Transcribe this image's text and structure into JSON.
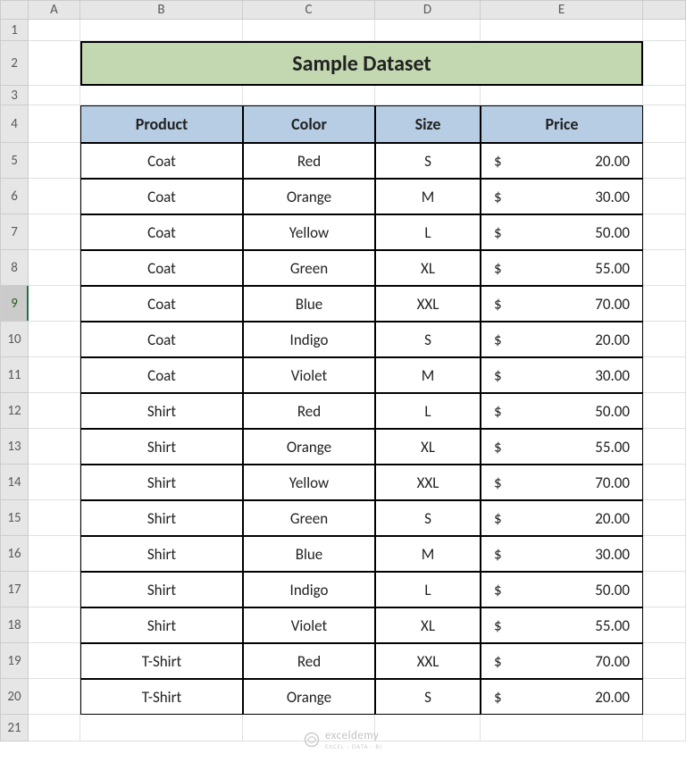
{
  "columns": [
    "A",
    "B",
    "C",
    "D",
    "E"
  ],
  "rows": [
    "1",
    "2",
    "3",
    "4",
    "5",
    "6",
    "7",
    "8",
    "9",
    "10",
    "11",
    "12",
    "13",
    "14",
    "15",
    "16",
    "17",
    "18",
    "19",
    "20",
    "21"
  ],
  "selected_row": "9",
  "title": "Sample Dataset",
  "headers": {
    "product": "Product",
    "color": "Color",
    "size": "Size",
    "price": "Price"
  },
  "currency_symbol": "$",
  "data_rows": [
    {
      "product": "Coat",
      "color": "Red",
      "size": "S",
      "price": "20.00"
    },
    {
      "product": "Coat",
      "color": "Orange",
      "size": "M",
      "price": "30.00"
    },
    {
      "product": "Coat",
      "color": "Yellow",
      "size": "L",
      "price": "50.00"
    },
    {
      "product": "Coat",
      "color": "Green",
      "size": "XL",
      "price": "55.00"
    },
    {
      "product": "Coat",
      "color": "Blue",
      "size": "XXL",
      "price": "70.00"
    },
    {
      "product": "Coat",
      "color": "Indigo",
      "size": "S",
      "price": "20.00"
    },
    {
      "product": "Coat",
      "color": "Violet",
      "size": "M",
      "price": "30.00"
    },
    {
      "product": "Shirt",
      "color": "Red",
      "size": "L",
      "price": "50.00"
    },
    {
      "product": "Shirt",
      "color": "Orange",
      "size": "XL",
      "price": "55.00"
    },
    {
      "product": "Shirt",
      "color": "Yellow",
      "size": "XXL",
      "price": "70.00"
    },
    {
      "product": "Shirt",
      "color": "Green",
      "size": "S",
      "price": "20.00"
    },
    {
      "product": "Shirt",
      "color": "Blue",
      "size": "M",
      "price": "30.00"
    },
    {
      "product": "Shirt",
      "color": "Indigo",
      "size": "L",
      "price": "50.00"
    },
    {
      "product": "Shirt",
      "color": "Violet",
      "size": "XL",
      "price": "55.00"
    },
    {
      "product": "T-Shirt",
      "color": "Red",
      "size": "XXL",
      "price": "70.00"
    },
    {
      "product": "T-Shirt",
      "color": "Orange",
      "size": "S",
      "price": "20.00"
    }
  ],
  "watermark": {
    "text": "exceldemy",
    "sub": "EXCEL · DATA · BI"
  }
}
